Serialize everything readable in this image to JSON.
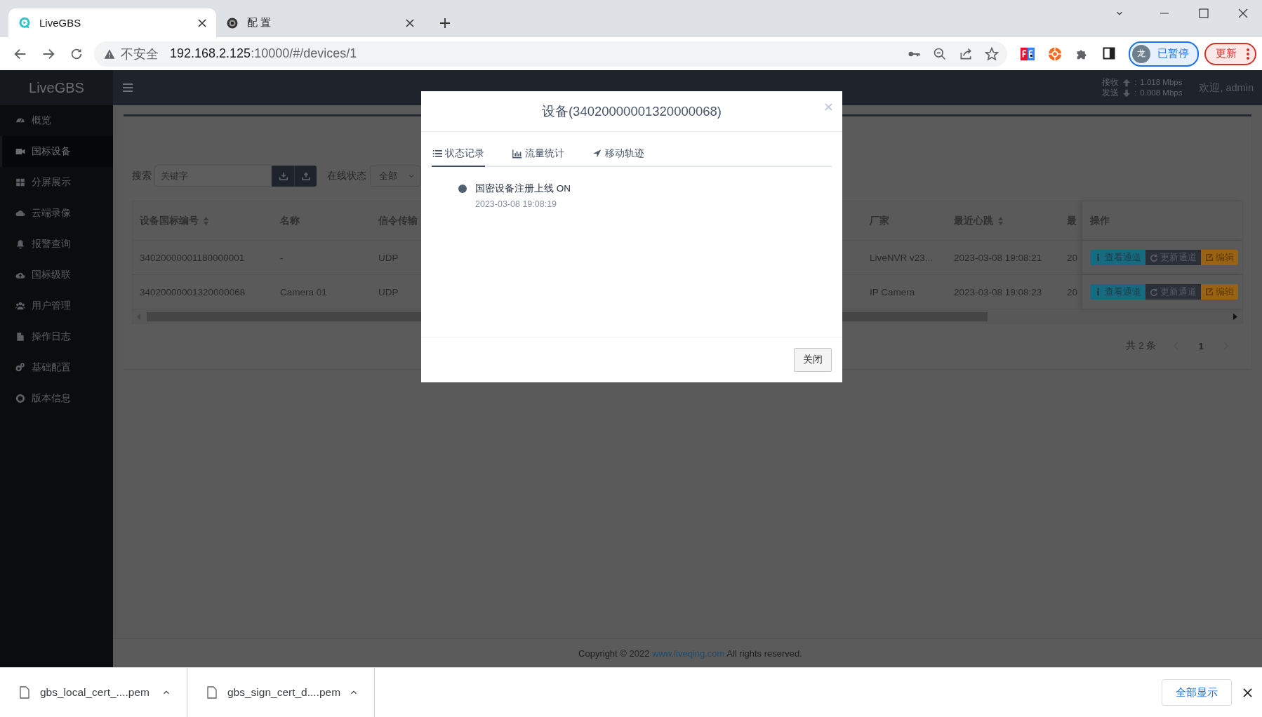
{
  "browser": {
    "tabs": [
      {
        "title": "LiveGBS",
        "selected": true
      },
      {
        "title": "配 置",
        "selected": false
      }
    ],
    "address": {
      "security": "不安全",
      "host": "192.168.2.125",
      "path": ":10000/#/devices/1"
    },
    "profile": {
      "avatar": "龙",
      "status": "已暂停"
    },
    "update_button": "更新"
  },
  "header": {
    "logo": "LiveGBS",
    "traffic": [
      {
        "label": "接收",
        "separator": ":",
        "value": "1.018 Mbps"
      },
      {
        "label": "发送",
        "separator": ":",
        "value": "0.008 Mbps"
      }
    ],
    "welcome": "欢迎, admin"
  },
  "sidebar": {
    "items": [
      {
        "label": "概览",
        "selected": false
      },
      {
        "label": "国标设备",
        "selected": true
      },
      {
        "label": "分屏展示",
        "selected": false
      },
      {
        "label": "云端录像",
        "selected": false
      },
      {
        "label": "报警查询",
        "selected": false
      },
      {
        "label": "国标级联",
        "selected": false
      },
      {
        "label": "用户管理",
        "selected": false
      },
      {
        "label": "操作日志",
        "selected": false
      },
      {
        "label": "基础配置",
        "selected": false
      },
      {
        "label": "版本信息",
        "selected": false
      }
    ]
  },
  "toolbar": {
    "search_label": "搜索",
    "search": {
      "placeholder": "关键字"
    },
    "status_label": "在线状态",
    "status_select": "全部"
  },
  "table": {
    "columns": [
      {
        "label": "设备国标编号",
        "sortable": true
      },
      {
        "label": "名称",
        "sortable": false
      },
      {
        "label": "信令传输"
      },
      {
        "label": "厂家",
        "sortable": false
      },
      {
        "label": "最近心跳",
        "sortable": true
      },
      {
        "label": "最"
      }
    ],
    "actions_column": "操作",
    "rows": [
      {
        "cells": [
          "34020000001180000001",
          "-",
          "UDP",
          "LiveNVR v23...",
          "2023-03-08 19:08:21",
          "20"
        ],
        "actions": [
          "查看通道",
          "更新通道",
          "编辑"
        ]
      },
      {
        "cells": [
          "34020000001320000068",
          "Camera 01",
          "UDP",
          "IP Camera",
          "2023-03-08 19:08:23",
          "20"
        ],
        "actions": [
          "查看通道",
          "更新通道",
          "编辑"
        ]
      }
    ]
  },
  "pagination": {
    "total": "共 2 条",
    "pages": [
      {
        "label": "1",
        "selected": true
      }
    ]
  },
  "footer": {
    "before": "Copyright © 2022",
    "link": "www.liveqing.com",
    "after": "All rights reserved."
  },
  "modal": {
    "title": "设备(34020000001320000068)",
    "tabs": [
      {
        "label": "状态记录",
        "selected": true
      },
      {
        "label": "流量统计",
        "selected": false
      },
      {
        "label": "移动轨迹",
        "selected": false
      }
    ],
    "events": [
      {
        "text": "国密设备注册上线 ON",
        "time": "2023-03-08 19:08:19"
      }
    ],
    "close_button": "关闭"
  },
  "downloads": {
    "files": [
      "gbs_local_cert_....pem",
      "gbs_sign_cert_d....pem"
    ],
    "show_all": "全部显示"
  }
}
